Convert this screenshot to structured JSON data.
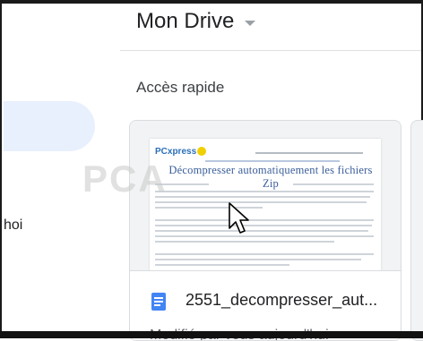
{
  "drive": {
    "title": "Mon Drive"
  },
  "sidebar": {
    "partial_label": "hoi"
  },
  "quick_access": {
    "title": "Accès rapide",
    "file": {
      "name": "2551_decompresser_aut...",
      "modified": "Modifié par vous aujourd'hui",
      "icon": "google-docs-icon"
    },
    "preview": {
      "logo": "PCxpress",
      "doc_title": "Décompresser automatiquement les fichiers Zip"
    }
  },
  "watermark": "PCA",
  "colors": {
    "docs_blue": "#4285f4",
    "sidebar_selected": "#e8f0fe"
  }
}
